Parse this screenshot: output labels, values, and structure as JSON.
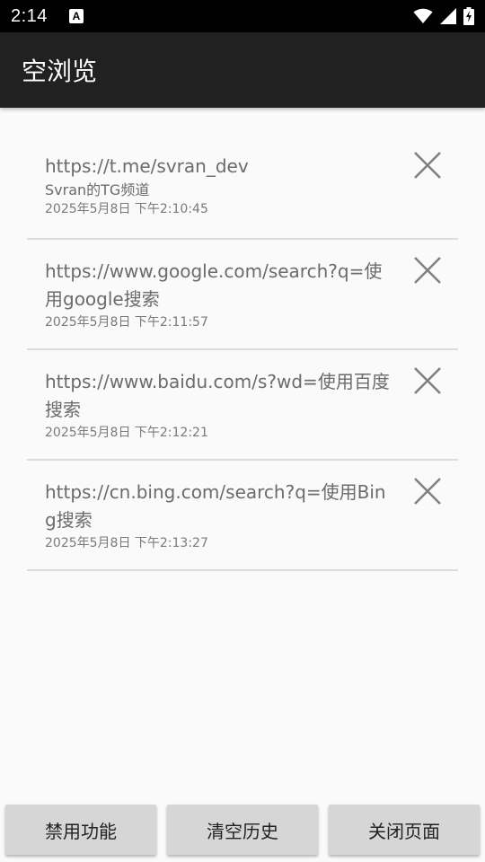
{
  "status_bar": {
    "time": "2:14",
    "notification_icon": "A"
  },
  "app": {
    "title": "空浏览"
  },
  "history": [
    {
      "url": "https://t.me/svran_dev",
      "title": "Svran的TG频道",
      "time": "2025年5月8日 下午2:10:45"
    },
    {
      "url": "https://www.google.com/search?q=使用google搜索",
      "time": "2025年5月8日 下午2:11:57"
    },
    {
      "url": "https://www.baidu.com/s?wd=使用百度搜索",
      "time": "2025年5月8日 下午2:12:21"
    },
    {
      "url": "https://cn.bing.com/search?q=使用Bing搜索",
      "time": "2025年5月8日 下午2:13:27"
    }
  ],
  "buttons": {
    "disable_features": "禁用功能",
    "clear_history": "清空历史",
    "close_page": "关闭页面"
  },
  "colors": {
    "app_bar": "#212121",
    "background": "#fafafa",
    "button": "#d6d6d6"
  }
}
